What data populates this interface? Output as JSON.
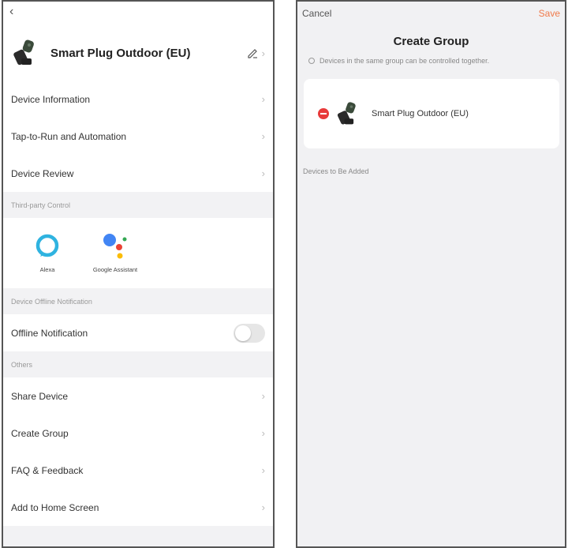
{
  "left": {
    "device_name": "Smart Plug Outdoor (EU)",
    "menu_top": [
      {
        "label": "Device Information"
      },
      {
        "label": "Tap-to-Run and Automation"
      },
      {
        "label": "Device Review"
      }
    ],
    "third_party_header": "Third-party Control",
    "third_party": [
      {
        "label": "Alexa",
        "icon": "alexa-icon"
      },
      {
        "label": "Google Assistant",
        "icon": "google-assistant-icon"
      }
    ],
    "offline_header": "Device Offline Notification",
    "offline_label": "Offline Notification",
    "offline_enabled": false,
    "others_header": "Others",
    "menu_others": [
      {
        "label": "Share Device"
      },
      {
        "label": "Create Group"
      },
      {
        "label": "FAQ & Feedback"
      },
      {
        "label": "Add to Home Screen"
      }
    ]
  },
  "right": {
    "cancel": "Cancel",
    "save": "Save",
    "title": "Create Group",
    "note": "Devices in the same group can be controlled together.",
    "group_device": "Smart Plug Outdoor (EU)",
    "to_add_header": "Devices to Be Added"
  },
  "colors": {
    "save": "#f07a4a",
    "remove": "#e83a3a",
    "alexa": "#2fb3e0",
    "google_blue": "#4285f4",
    "google_red": "#ea4335",
    "google_yellow": "#fbbc05",
    "google_green": "#34a853"
  }
}
